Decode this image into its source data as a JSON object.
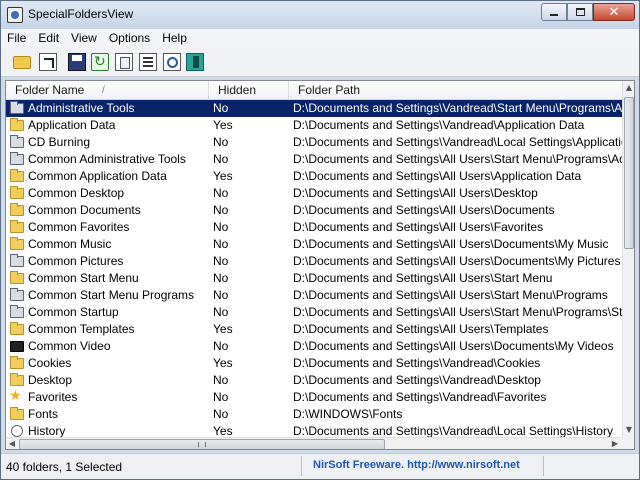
{
  "window": {
    "title": "SpecialFoldersView"
  },
  "menu": [
    "File",
    "Edit",
    "View",
    "Options",
    "Help"
  ],
  "toolbar": [
    {
      "icon": "open-folder-icon"
    },
    {
      "icon": "open-shortcut-icon"
    },
    {
      "icon": "save-icon"
    },
    {
      "icon": "refresh-icon"
    },
    {
      "icon": "copy-icon"
    },
    {
      "icon": "properties-icon"
    },
    {
      "icon": "find-icon"
    },
    {
      "icon": "exit-icon"
    }
  ],
  "columns": {
    "name": "Folder Name",
    "sort": "/",
    "hidden": "Hidden",
    "path": "Folder Path"
  },
  "rows": [
    {
      "name": "Administrative Tools",
      "hidden": "No",
      "path": "D:\\Documents and Settings\\Vandread\\Start Menu\\Programs\\Adm",
      "icon": "sys",
      "selected": true
    },
    {
      "name": "Application Data",
      "hidden": "Yes",
      "path": "D:\\Documents and Settings\\Vandread\\Application Data",
      "icon": "folder"
    },
    {
      "name": "CD Burning",
      "hidden": "No",
      "path": "D:\\Documents and Settings\\Vandread\\Local Settings\\Application",
      "icon": "sys"
    },
    {
      "name": "Common Administrative Tools",
      "hidden": "No",
      "path": "D:\\Documents and Settings\\All Users\\Start Menu\\Programs\\Adm",
      "icon": "sys"
    },
    {
      "name": "Common Application Data",
      "hidden": "Yes",
      "path": "D:\\Documents and Settings\\All Users\\Application Data",
      "icon": "folder"
    },
    {
      "name": "Common Desktop",
      "hidden": "No",
      "path": "D:\\Documents and Settings\\All Users\\Desktop",
      "icon": "folder"
    },
    {
      "name": "Common Documents",
      "hidden": "No",
      "path": "D:\\Documents and Settings\\All Users\\Documents",
      "icon": "folder"
    },
    {
      "name": "Common Favorites",
      "hidden": "No",
      "path": "D:\\Documents and Settings\\All Users\\Favorites",
      "icon": "folder"
    },
    {
      "name": "Common Music",
      "hidden": "No",
      "path": "D:\\Documents and Settings\\All Users\\Documents\\My Music",
      "icon": "folder"
    },
    {
      "name": "Common Pictures",
      "hidden": "No",
      "path": "D:\\Documents and Settings\\All Users\\Documents\\My Pictures",
      "icon": "sys"
    },
    {
      "name": "Common Start Menu",
      "hidden": "No",
      "path": "D:\\Documents and Settings\\All Users\\Start Menu",
      "icon": "folder"
    },
    {
      "name": "Common Start Menu Programs",
      "hidden": "No",
      "path": "D:\\Documents and Settings\\All Users\\Start Menu\\Programs",
      "icon": "sys"
    },
    {
      "name": "Common Startup",
      "hidden": "No",
      "path": "D:\\Documents and Settings\\All Users\\Start Menu\\Programs\\Startup",
      "icon": "sys"
    },
    {
      "name": "Common Templates",
      "hidden": "Yes",
      "path": "D:\\Documents and Settings\\All Users\\Templates",
      "icon": "folder"
    },
    {
      "name": "Common Video",
      "hidden": "No",
      "path": "D:\\Documents and Settings\\All Users\\Documents\\My Videos",
      "icon": "video"
    },
    {
      "name": "Cookies",
      "hidden": "Yes",
      "path": "D:\\Documents and Settings\\Vandread\\Cookies",
      "icon": "folder"
    },
    {
      "name": "Desktop",
      "hidden": "No",
      "path": "D:\\Documents and Settings\\Vandread\\Desktop",
      "icon": "folder"
    },
    {
      "name": "Favorites",
      "hidden": "No",
      "path": "D:\\Documents and Settings\\Vandread\\Favorites",
      "icon": "star"
    },
    {
      "name": "Fonts",
      "hidden": "No",
      "path": "D:\\WINDOWS\\Fonts",
      "icon": "folder"
    },
    {
      "name": "History",
      "hidden": "Yes",
      "path": "D:\\Documents and Settings\\Vandread\\Local Settings\\History",
      "icon": "history"
    }
  ],
  "status": {
    "count": "40 folders, 1 Selected",
    "credit": "NirSoft Freeware.  http://www.nirsoft.net"
  }
}
